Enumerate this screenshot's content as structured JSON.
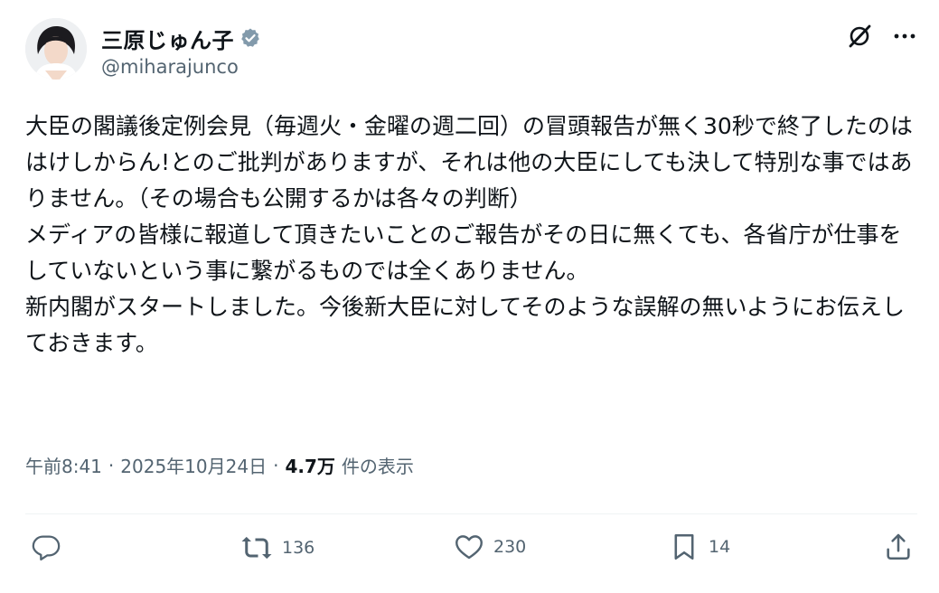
{
  "author": {
    "display_name": "三原じゅん子",
    "handle": "@miharajunco",
    "verified": true
  },
  "tweet": {
    "text": "大臣の閣議後定例会見（毎週火・金曜の週二回）の冒頭報告が無く30秒で終了したのははけしからん!とのご批判がありますが、それは他の大臣にしても決して特別な事ではありません。（その場合も公開するかは各々の判断）\nメディアの皆様に報道して頂きたいことのご報告がその日に無くても、各省庁が仕事をしていないという事に繋がるものでは全くありません。\n新内閣がスタートしました。今後新大臣に対してそのような誤解の無いようにお伝えしておきます。"
  },
  "meta": {
    "time": "午前8:41",
    "sep": "·",
    "date": "2025年10月24日",
    "views_count": "4.7万",
    "views_label": "件の表示"
  },
  "actions": {
    "reply_count": "",
    "retweet_count": "136",
    "like_count": "230",
    "bookmark_count": "14"
  },
  "icons": {
    "verified": "verified-badge-icon",
    "grok": "grok-icon",
    "more": "more-icon",
    "reply": "reply-icon",
    "retweet": "retweet-icon",
    "like": "heart-icon",
    "bookmark": "bookmark-icon",
    "share": "share-icon"
  },
  "colors": {
    "text": "#0f1419",
    "secondary": "#536471",
    "verified": "#829aab"
  }
}
